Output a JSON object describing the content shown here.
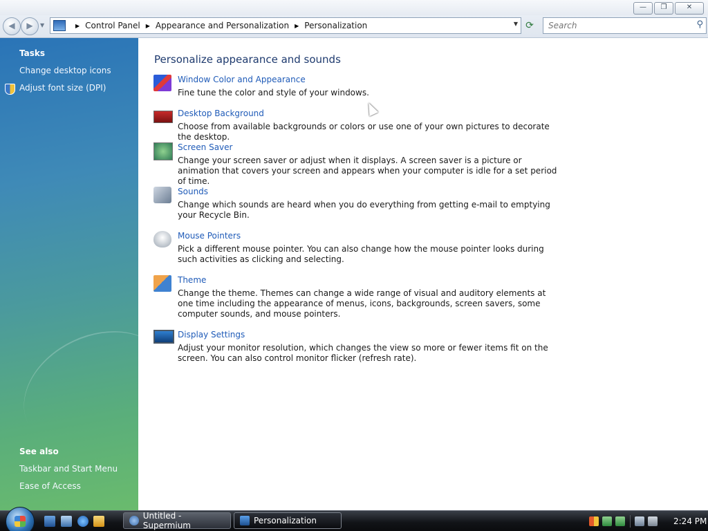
{
  "window": {
    "minimize_glyph": "—",
    "maximize_glyph": "❐",
    "close_glyph": "✕"
  },
  "navigation": {
    "back_glyph": "◀",
    "forward_glyph": "▶",
    "breadcrumbs": [
      "Control Panel",
      "Appearance and Personalization",
      "Personalization"
    ],
    "search_placeholder": "Search",
    "icons": [
      "back-arrow-icon",
      "forward-arrow-icon",
      "control-panel-icon",
      "refresh-icon",
      "search-icon"
    ]
  },
  "sidebar": {
    "tasks_heading": "Tasks",
    "tasks": [
      {
        "label": "Change desktop icons"
      },
      {
        "label": "Adjust font size (DPI)",
        "icon": "uac-shield-icon"
      }
    ],
    "see_also_heading": "See also",
    "see_also": [
      {
        "label": "Taskbar and Start Menu"
      },
      {
        "label": "Ease of Access"
      }
    ]
  },
  "main": {
    "title": "Personalize appearance and sounds",
    "items": [
      {
        "title": "Window Color and Appearance",
        "description": "Fine tune the color and style of your windows.",
        "icon": "window-color-icon"
      },
      {
        "title": "Desktop Background",
        "description": "Choose from available backgrounds or colors or use one of your own pictures to decorate the desktop.",
        "icon": "desktop-background-icon"
      },
      {
        "title": "Screen Saver",
        "description": "Change your screen saver or adjust when it displays. A screen saver is a picture or animation that covers your screen and appears when your computer is idle for a set period of time.",
        "icon": "screen-saver-icon"
      },
      {
        "title": "Sounds",
        "description": "Change which sounds are heard when you do everything from getting e-mail to emptying your Recycle Bin.",
        "icon": "sounds-icon"
      },
      {
        "title": "Mouse Pointers",
        "description": "Pick a different mouse pointer. You can also change how the mouse pointer looks during such activities as clicking and selecting.",
        "icon": "mouse-pointers-icon"
      },
      {
        "title": "Theme",
        "description": "Change the theme. Themes can change a wide range of visual and auditory elements at one time including the appearance of menus, icons, backgrounds, screen savers, some computer sounds, and mouse pointers.",
        "icon": "theme-icon"
      },
      {
        "title": "Display Settings",
        "description": "Adjust your monitor resolution, which changes the view so more or fewer items fit on the screen. You can also control monitor flicker (refresh rate).",
        "icon": "display-settings-icon"
      }
    ]
  },
  "taskbar": {
    "tasks": [
      {
        "label": "Untitled - Supermium",
        "active": false
      },
      {
        "label": "Personalization",
        "active": true
      }
    ],
    "clock": "2:24 PM"
  },
  "colors": {
    "link": "#1f5bb8",
    "heading": "#1e3a6e",
    "sidebar_top": "#2a74b7",
    "sidebar_bottom": "#6abb6d"
  }
}
